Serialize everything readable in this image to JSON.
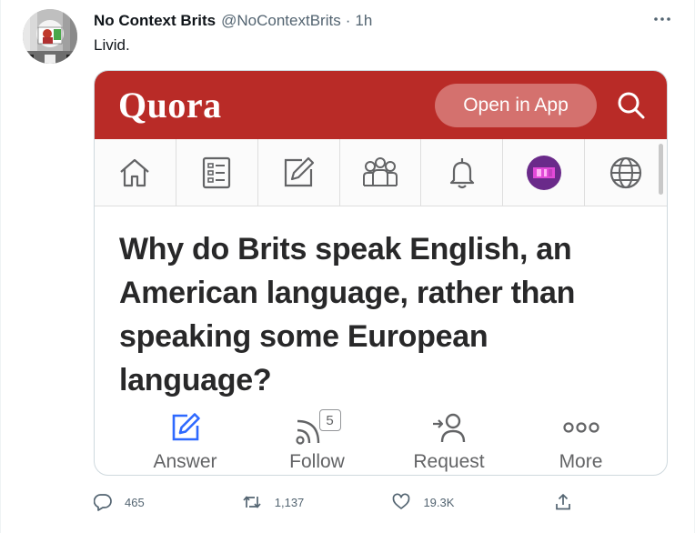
{
  "tweet": {
    "author_name": "No Context Brits",
    "author_handle": "@NoContextBrits",
    "separator": "·",
    "time": "1h",
    "text": "Livid."
  },
  "quora_card": {
    "logo": "Quora",
    "open_in_app_label": "Open in App",
    "brand_color": "#b92b27",
    "nav_icons": [
      "home-icon",
      "answer-list-icon",
      "write-icon",
      "spaces-icon",
      "notifications-icon",
      "profile-avatar",
      "language-globe-icon"
    ],
    "question": "Why do Brits speak English, an American language, rather than speaking some European language?",
    "actions": [
      {
        "icon": "answer-edit-icon",
        "label": "Answer"
      },
      {
        "icon": "follow-rss-icon",
        "label": "Follow",
        "badge": "5"
      },
      {
        "icon": "request-user-icon",
        "label": "Request"
      },
      {
        "icon": "more-dots-icon",
        "label": "More"
      }
    ]
  },
  "stats": {
    "replies": "465",
    "retweets": "1,137",
    "likes": "19.3K"
  }
}
